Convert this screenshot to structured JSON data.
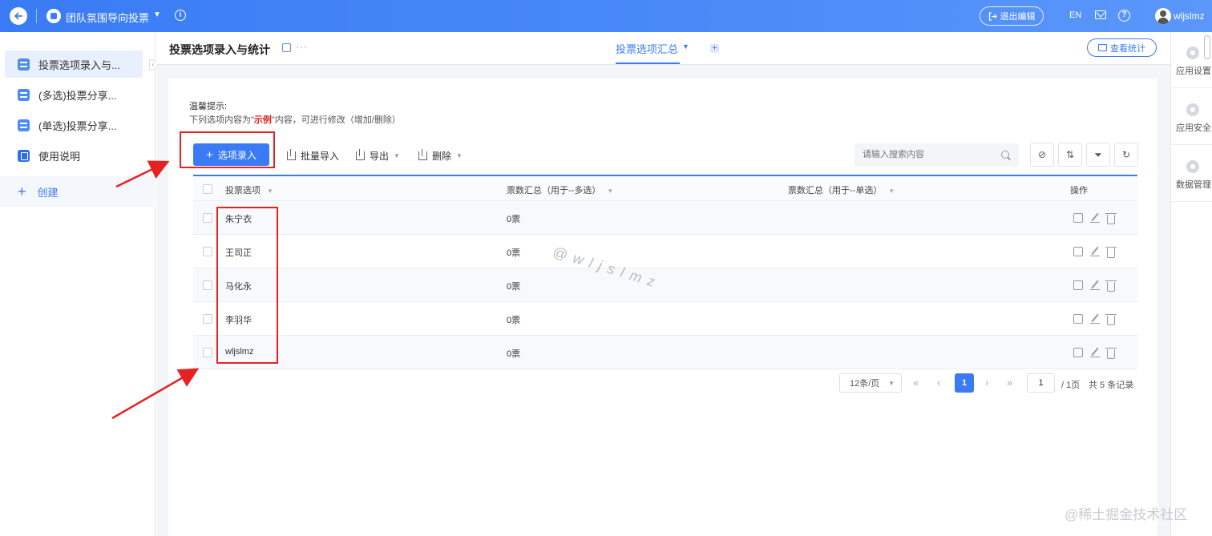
{
  "topbar": {
    "app_name": "团队氛围导向投票",
    "exit_edit_label": "退出编辑",
    "lang_label": "EN",
    "username": "wljslmz"
  },
  "sidebar": {
    "items": [
      {
        "label": "投票选项录入与..."
      },
      {
        "label": "(多选)投票分享..."
      },
      {
        "label": "(单选)投票分享..."
      },
      {
        "label": "使用说明"
      }
    ],
    "create_label": "创建"
  },
  "header": {
    "page_title": "投票选项录入与统计",
    "more": "···",
    "view_tab": "投票选项汇总",
    "stats_button": "查看统计"
  },
  "right_rail": {
    "items": [
      {
        "label": "应用设置"
      },
      {
        "label": "应用安全"
      },
      {
        "label": "数据管理"
      }
    ]
  },
  "tip": {
    "title": "温馨提示:",
    "prefix": "下列选项内容为\"",
    "highlight": "示例",
    "suffix": "\"内容，可进行修改（增加/删除）"
  },
  "toolbar": {
    "add_label": "选项录入",
    "bulk_import_label": "批量导入",
    "export_label": "导出",
    "delete_label": "删除",
    "search_placeholder": "请输入搜索内容"
  },
  "table": {
    "headers": {
      "name": "投票选项",
      "multi": "票数汇总（用于--多选）",
      "single": "票数汇总（用于--单选）",
      "ops": "操作"
    },
    "rows": [
      {
        "name": "朱宁衣",
        "multi": "0票"
      },
      {
        "name": "王司正",
        "multi": "0票"
      },
      {
        "name": "马化永",
        "multi": "0票"
      },
      {
        "name": "李羽华",
        "multi": "0票"
      },
      {
        "name": "wljslmz",
        "multi": "0票"
      }
    ]
  },
  "pagination": {
    "page_size": "12条/页",
    "current_page": "1",
    "page_input": "1",
    "total_pages": "/ 1页",
    "total_records": "共 5 条记录"
  },
  "watermarks": {
    "center": "@wljslmz",
    "corner": "@稀土掘金技术社区"
  },
  "colors": {
    "brand": "#3a7bf5",
    "annotation_red": "#e52222",
    "highlight_red": "#e02020"
  }
}
